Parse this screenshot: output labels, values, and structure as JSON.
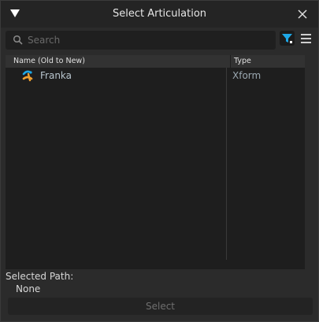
{
  "window": {
    "title": "Select Articulation"
  },
  "search": {
    "placeholder": "Search",
    "icon": "search-icon"
  },
  "toolbar": {
    "filter_icon": "filter-icon",
    "menu_icon": "hamburger-menu-icon",
    "accent_color": "#1ea7e6"
  },
  "tree": {
    "columns": [
      {
        "label": "Name (Old to New)"
      },
      {
        "label": "Type"
      }
    ],
    "rows": [
      {
        "name": "Franka",
        "type": "Xform",
        "icon": "articulation-icon"
      }
    ]
  },
  "selected": {
    "label": "Selected Path:",
    "value": "None"
  },
  "actions": {
    "select_label": "Select"
  }
}
